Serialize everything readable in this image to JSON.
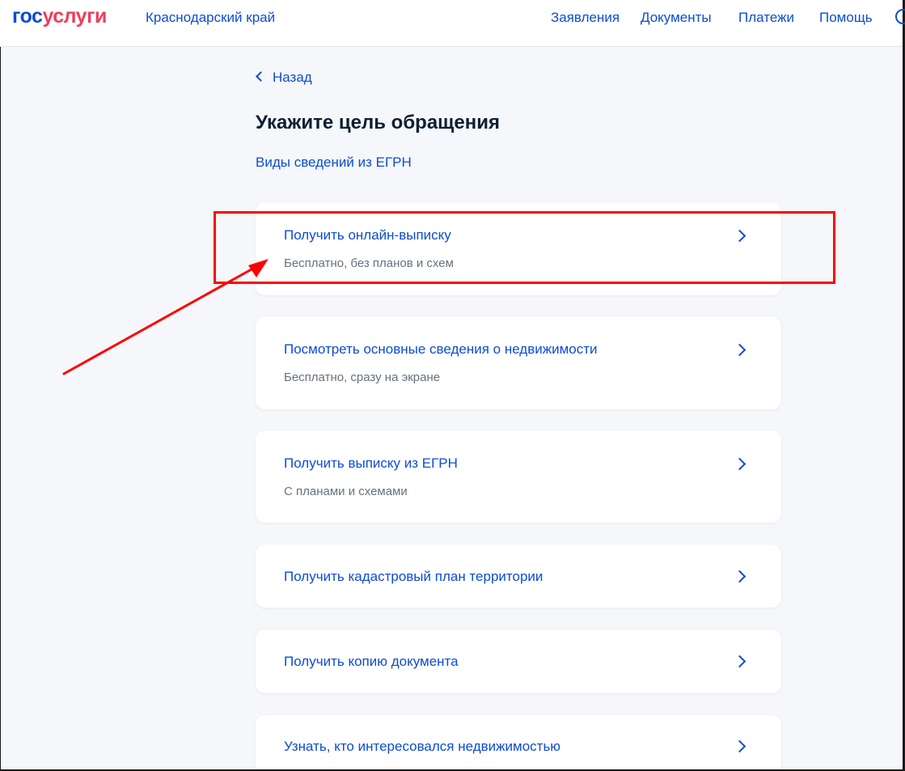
{
  "header": {
    "logo_part1": "гос",
    "logo_part2": "услуги",
    "region": "Краснодарский край",
    "nav": [
      "Заявления",
      "Документы",
      "Платежи",
      "Помощь"
    ]
  },
  "main": {
    "back_label": "Назад",
    "title": "Укажите цель обращения",
    "subtitle_link": "Виды сведений из ЕГРН",
    "options": [
      {
        "title": "Получить онлайн-выписку",
        "description": "Бесплатно, без планов и схем"
      },
      {
        "title": "Посмотреть основные сведения о недвижимости",
        "description": "Бесплатно, сразу на экране"
      },
      {
        "title": "Получить выписку из ЕГРН",
        "description": "С планами и схемами"
      },
      {
        "title": "Получить кадастровый план территории",
        "description": ""
      },
      {
        "title": "Получить копию документа",
        "description": ""
      },
      {
        "title": "Узнать, кто интересовался недвижимостью",
        "description": ""
      }
    ]
  },
  "annotation": {
    "highlighted_option": "Получить онлайн-выписку",
    "color": "#ff0000"
  },
  "colors": {
    "link_blue": "#0d4cd3",
    "logo_red": "#ee3f58",
    "background": "#f5f7fa",
    "card": "#ffffff",
    "muted_text": "#66727f"
  }
}
